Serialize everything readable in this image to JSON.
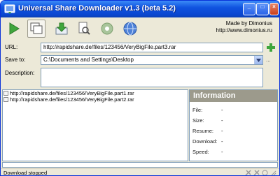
{
  "window": {
    "title": "Universal Share Downloader v1.3 (beta 5.2)"
  },
  "titlebar_buttons": {
    "minimize": "_",
    "maximize": "□",
    "close": "×"
  },
  "toolbar": {
    "tools": [
      {
        "name": "start-icon"
      },
      {
        "name": "windows-icon"
      },
      {
        "name": "download-icon"
      },
      {
        "name": "document-search-icon"
      },
      {
        "name": "settings-icon"
      },
      {
        "name": "help-icon"
      }
    ],
    "made_by": "Made by Dimonius",
    "url": "http://www.dimonius.ru"
  },
  "form": {
    "url_label": "URL:",
    "url_value": "http://rapidshare.de/files/123456/VeryBigFile.part3.rar",
    "save_label": "Save to:",
    "save_value": "C:\\Documents and Settings\\Desktop",
    "desc_label": "Description:",
    "desc_value": "",
    "browse_label": "..."
  },
  "list": {
    "items": [
      "http://rapidshare.de/files/123456/VeryBigFile.part1.rar",
      "http://rapidshare.de/files/123456/VeryBigFile.part2.rar"
    ]
  },
  "info": {
    "title": "Information",
    "rows": [
      {
        "label": "File:",
        "value": "-"
      },
      {
        "label": "Size:",
        "value": "-"
      },
      {
        "label": "Resume:",
        "value": "-"
      },
      {
        "label": "Download:",
        "value": "-"
      },
      {
        "label": "Speed:",
        "value": "-"
      }
    ]
  },
  "status": {
    "text": "Download stopped"
  },
  "colors": {
    "title_bar": "#0a46d0",
    "accent_green": "#3fa63c",
    "panel_header": "#9c9a8c"
  }
}
